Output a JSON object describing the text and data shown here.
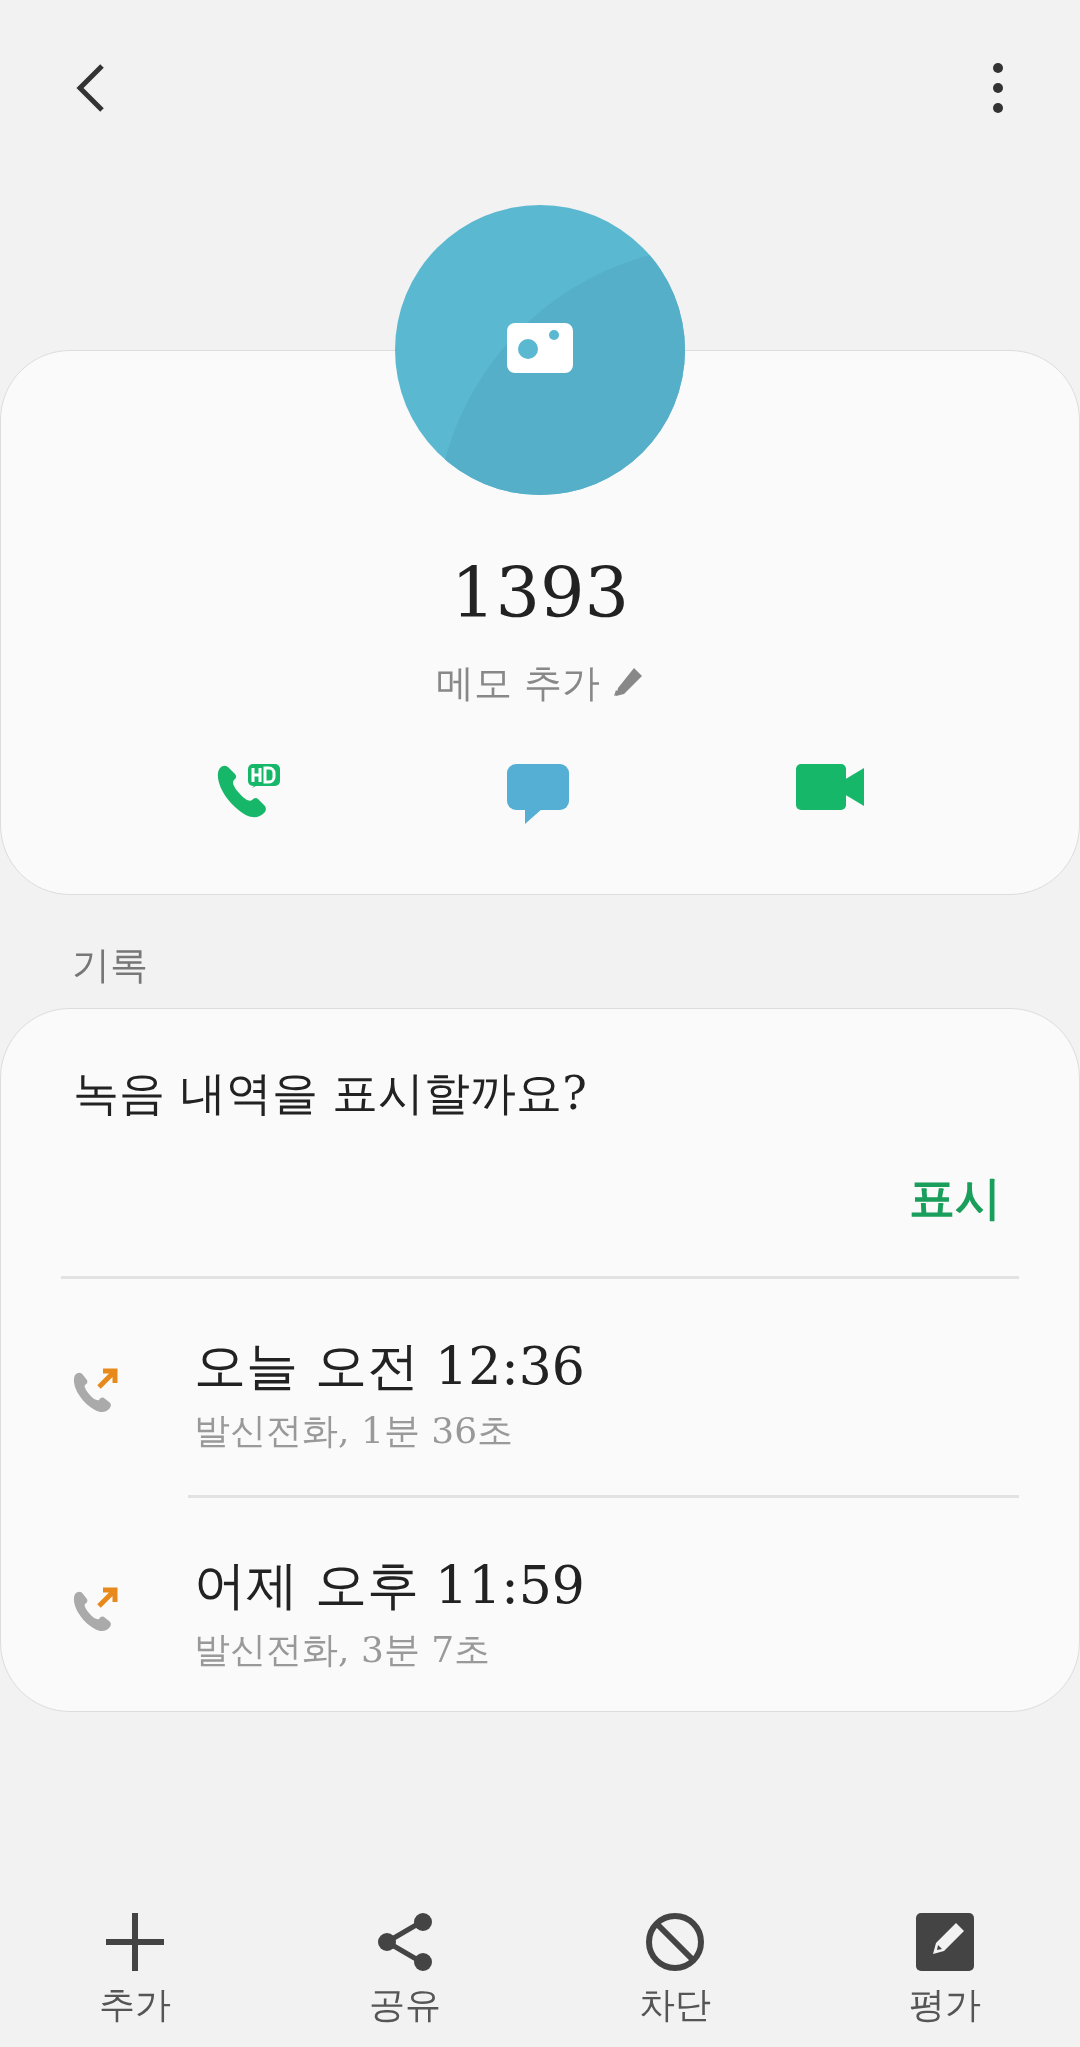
{
  "contact": {
    "number": "1393",
    "memo": "메모 추가"
  },
  "history": {
    "label": "기록",
    "prompt": "녹음 내역을 표시할까요?",
    "show_button": "표시",
    "calls": [
      {
        "kind": "outgoing",
        "time": "오늘 오전 12:36",
        "detail": "발신전화, 1분 36초"
      },
      {
        "kind": "outgoing",
        "time": "어제 오후 11:59",
        "detail": "발신전화, 3분 7초"
      }
    ]
  },
  "bottom_nav": [
    {
      "kind": "add",
      "label": "추가"
    },
    {
      "kind": "share",
      "label": "공유"
    },
    {
      "kind": "block",
      "label": "차단"
    },
    {
      "kind": "rate",
      "label": "평가"
    }
  ]
}
